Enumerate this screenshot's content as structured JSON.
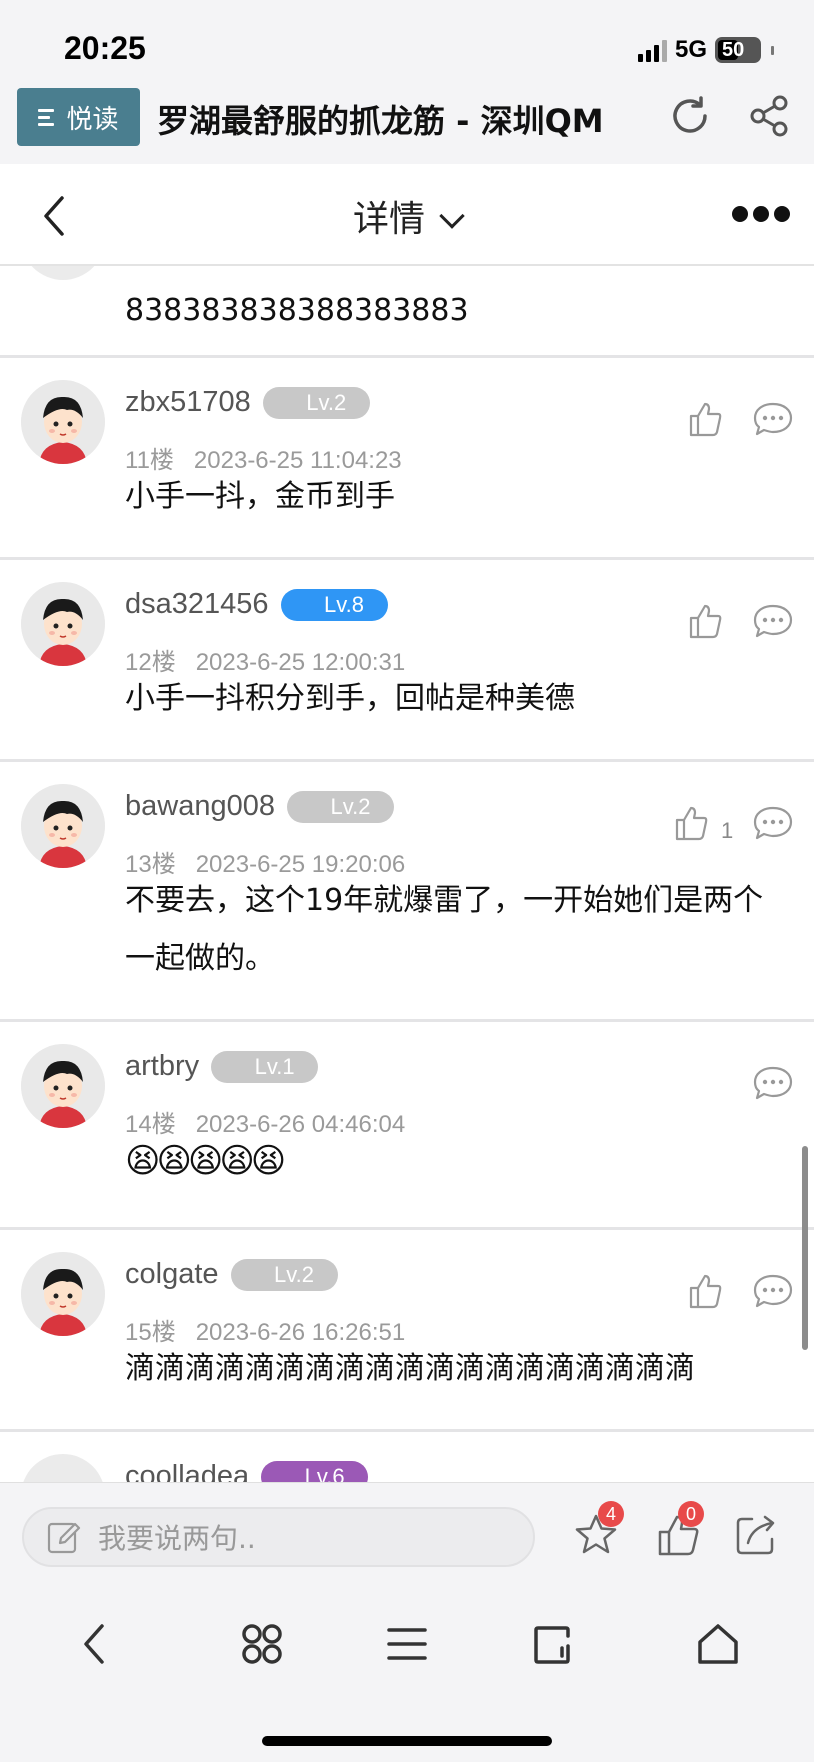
{
  "status_bar": {
    "time": "20:25",
    "network": "5G",
    "battery": "50"
  },
  "app_header": {
    "menu_label": "悦读",
    "title": "罗湖最舒服的抓龙筋 - 深圳QM",
    "icons": [
      "refresh-icon",
      "share-icon"
    ]
  },
  "nav": {
    "back_icon": "chevron-left-icon",
    "title": "详情",
    "more_icon": "more-dots-icon"
  },
  "partial_post": {
    "content": "838383838388383883"
  },
  "posts": [
    {
      "username": "zbx51708",
      "level": "Lv.2",
      "level_color": "#c8c8c8",
      "floor": "11楼",
      "time": "2023-6-25 11:04:23",
      "content": "小手一抖，金币到手",
      "likes": ""
    },
    {
      "username": "dsa321456",
      "level": "Lv.8",
      "level_color": "#2f96f5",
      "floor": "12楼",
      "time": "2023-6-25 12:00:31",
      "content": "小手一抖积分到手，回帖是种美德",
      "likes": ""
    },
    {
      "username": "bawang008",
      "level": "Lv.2",
      "level_color": "#c8c8c8",
      "floor": "13楼",
      "time": "2023-6-25 19:20:06",
      "content": "不要去，这个19年就爆雷了，一开始她们是两个一起做的。",
      "likes": "1"
    },
    {
      "username": "artbry",
      "level": "Lv.1",
      "level_color": "#c8c8c8",
      "floor": "14楼",
      "time": "2023-6-26 04:46:04",
      "content": "😫😫😫😫😫",
      "likes": ""
    },
    {
      "username": "colgate",
      "level": "Lv.2",
      "level_color": "#c8c8c8",
      "floor": "15楼",
      "time": "2023-6-26 16:26:51",
      "content": "滴滴滴滴滴滴滴滴滴滴滴滴滴滴滴滴滴滴滴",
      "likes": ""
    },
    {
      "username": "coolladea",
      "level": "Lv.6",
      "level_color": "#9b59b6"
    }
  ],
  "comment_bar": {
    "placeholder": "我要说两句..",
    "favorite_count": "4",
    "like_count": "0"
  },
  "toolbar": {
    "icons": [
      "back-icon",
      "clover-icon",
      "menu-icon",
      "tabs-icon",
      "home-icon"
    ]
  }
}
